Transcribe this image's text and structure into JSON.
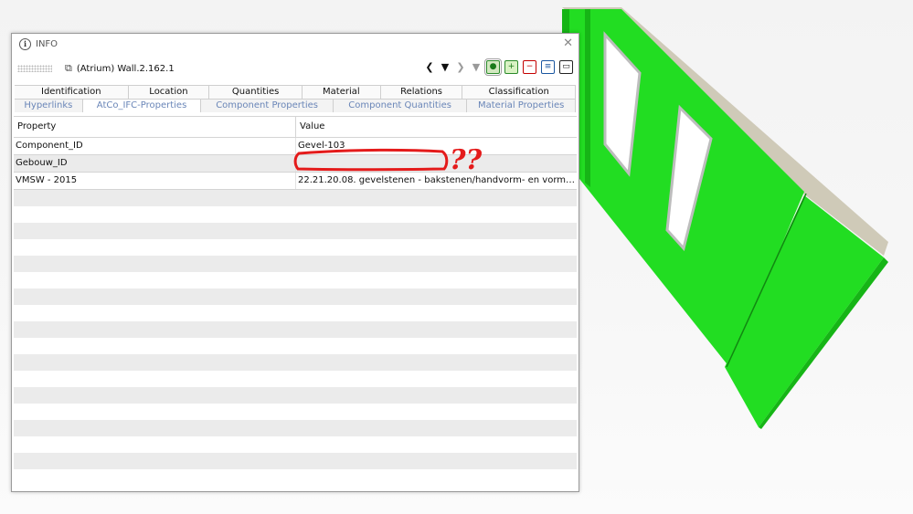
{
  "window": {
    "title": "INFO",
    "close_glyph": "✕",
    "info_glyph": "i",
    "object_label": "(Atrium) Wall.2.162.1"
  },
  "toolbar": {
    "object_icon": "wall-object-icon",
    "prev_glyph": "❮",
    "menu_glyph": "▼",
    "next_glyph": "❯",
    "more_glyph": "▼"
  },
  "tabs_row1": [
    {
      "label": "Identification"
    },
    {
      "label": "Location"
    },
    {
      "label": "Quantities"
    },
    {
      "label": "Material"
    },
    {
      "label": "Relations"
    },
    {
      "label": "Classification"
    }
  ],
  "tabs_row2": [
    {
      "label": "Hyperlinks"
    },
    {
      "label": "AtCo_IFC-Properties",
      "active": true
    },
    {
      "label": "Component Properties"
    },
    {
      "label": "Component Quantities"
    },
    {
      "label": "Material Properties"
    }
  ],
  "grid": {
    "headers": {
      "property": "Property",
      "value": "Value"
    },
    "rows": [
      {
        "property": "Component_ID",
        "value": "Gevel-103"
      },
      {
        "property": "Gebouw_ID",
        "value": ""
      },
      {
        "property": "VMSW - 2015",
        "value": "22.21.20.08. gevelstenen - bakstenen/handvorm- en vormbakstenen..."
      }
    ]
  },
  "annotation": {
    "text": "??",
    "color": "#e41b1b"
  },
  "colors": {
    "wall_green": "#22dd22",
    "wall_green_dark": "#15b015",
    "wall_top": "#cfcab8",
    "window_frame": "#bdbdbd"
  }
}
